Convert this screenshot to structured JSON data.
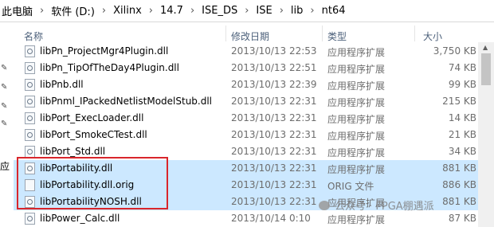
{
  "breadcrumb": {
    "items": [
      "此电脑",
      "软件 (D:)",
      "Xilinx",
      "14.7",
      "ISE_DS",
      "ISE",
      "lib",
      "nt64"
    ]
  },
  "nav": {
    "visible_char": "应"
  },
  "columns": {
    "name": "名称",
    "date": "修改日期",
    "type": "类型",
    "size": "大小"
  },
  "files": [
    {
      "name": "libPn_ProjectMgr4Plugin.dll",
      "date": "2013/10/13 22:53",
      "type": "应用程序扩展",
      "size": "3,750 KB",
      "selected": false,
      "icon": "dll-file-icon"
    },
    {
      "name": "libPn_TipOfTheDay4Plugin.dll",
      "date": "2013/10/13 22:51",
      "type": "应用程序扩展",
      "size": "74 KB",
      "selected": false,
      "icon": "dll-file-icon"
    },
    {
      "name": "libPnb.dll",
      "date": "2013/10/13 22:39",
      "type": "应用程序扩展",
      "size": "99 KB",
      "selected": false,
      "icon": "dll-file-icon"
    },
    {
      "name": "libPnml_IPackedNetlistModelStub.dll",
      "date": "2013/10/13 22:31",
      "type": "应用程序扩展",
      "size": "215 KB",
      "selected": false,
      "icon": "dll-file-icon"
    },
    {
      "name": "libPort_ExecLoader.dll",
      "date": "2013/10/13 22:31",
      "type": "应用程序扩展",
      "size": "14 KB",
      "selected": false,
      "icon": "dll-file-icon"
    },
    {
      "name": "libPort_SmokeCTest.dll",
      "date": "2013/10/13 22:31",
      "type": "应用程序扩展",
      "size": "21 KB",
      "selected": false,
      "icon": "dll-file-icon"
    },
    {
      "name": "libPort_Std.dll",
      "date": "2013/10/13 22:31",
      "type": "应用程序扩展",
      "size": "34 KB",
      "selected": false,
      "icon": "dll-file-icon"
    },
    {
      "name": "libPortability.dll",
      "date": "2013/10/13 22:31",
      "type": "应用程序扩展",
      "size": "881 KB",
      "selected": true,
      "icon": "dll-file-icon"
    },
    {
      "name": "libPortability.dll.orig",
      "date": "2013/10/13 22:31",
      "type": "ORIG 文件",
      "size": "886 KB",
      "selected": true,
      "icon": "generic-file-icon"
    },
    {
      "name": "libPortabilityNOSH.dll",
      "date": "2013/10/13 22:31",
      "type": "应用程序扩展",
      "size": "881 KB",
      "selected": true,
      "icon": "dll-file-icon"
    },
    {
      "name": "libPower_Calc.dll",
      "date": "2013/10/14 0:10",
      "type": "应用程序扩展",
      "size": "87 KB",
      "selected": false,
      "icon": "dll-file-icon"
    }
  ],
  "watermark": {
    "text": "公众号 · FPGA棚遇派"
  },
  "colors": {
    "selection": "#cce8ff",
    "highlight_box": "#d9262b",
    "header_text": "#4c607a"
  }
}
